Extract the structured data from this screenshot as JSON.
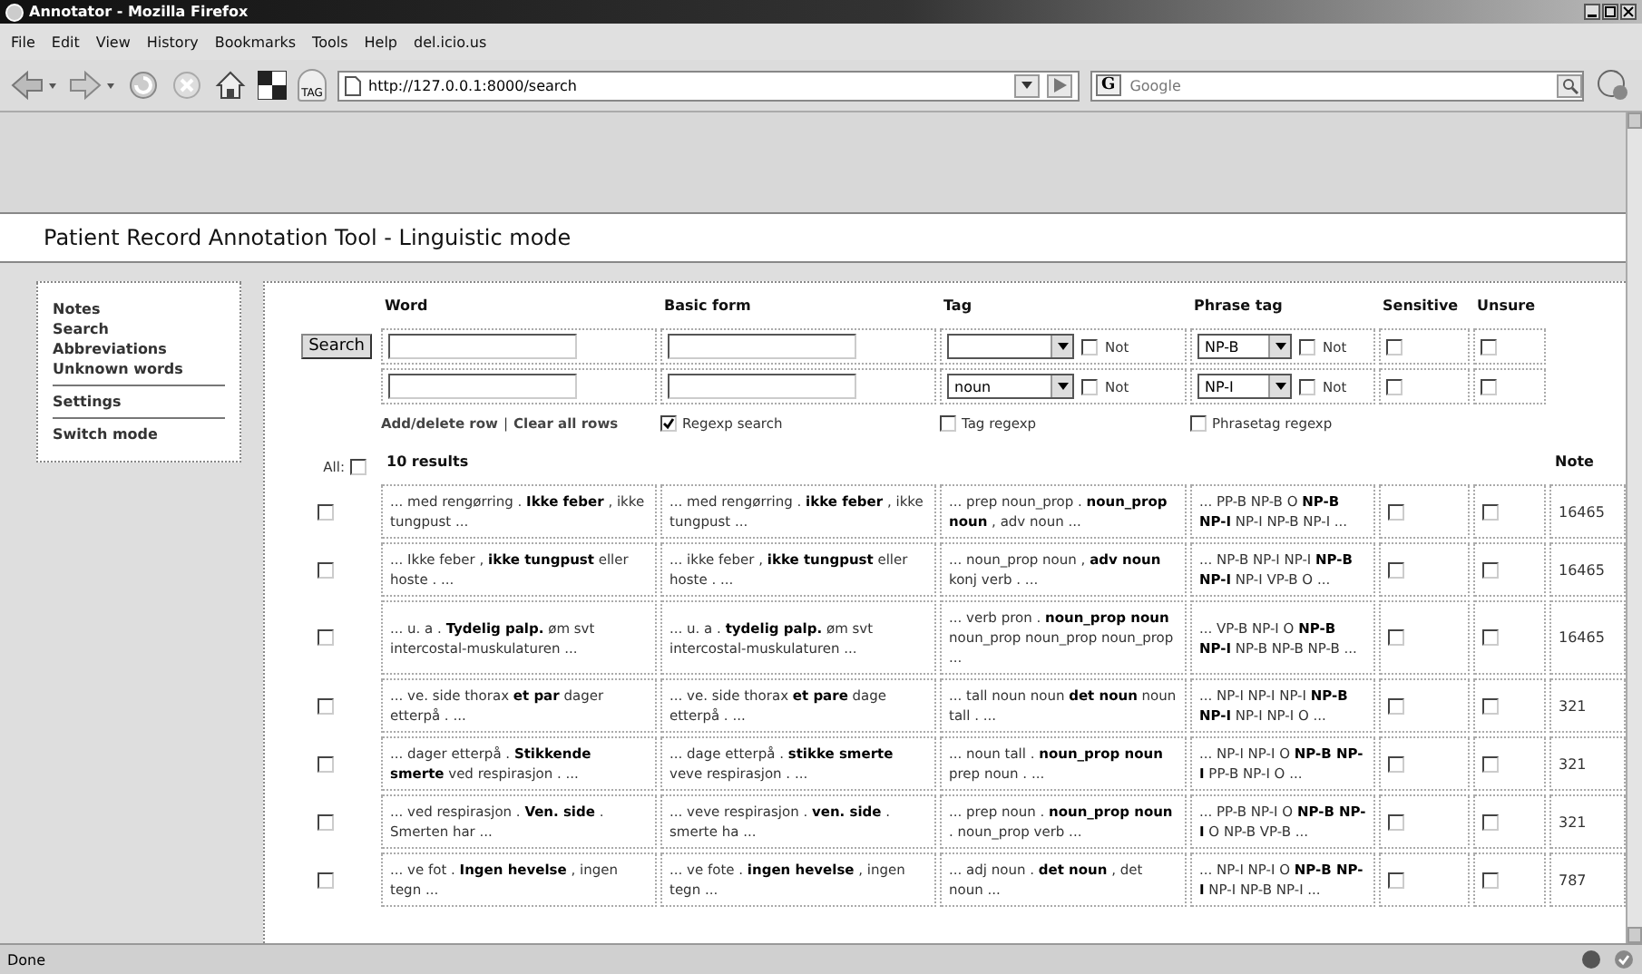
{
  "window": {
    "title": "Annotator - Mozilla Firefox"
  },
  "menu": [
    "File",
    "Edit",
    "View",
    "History",
    "Bookmarks",
    "Tools",
    "Help",
    "del.icio.us"
  ],
  "toolbar": {
    "tag_label": "TAG",
    "url": "http://127.0.0.1:8000/search",
    "search_engine": "G",
    "search_placeholder": "Google"
  },
  "page_title": "Patient Record Annotation Tool - Linguistic mode",
  "sidebar": {
    "groups": [
      [
        "Notes",
        "Search",
        "Abbreviations",
        "Unknown words"
      ],
      [
        "Settings"
      ],
      [
        "Switch mode"
      ]
    ]
  },
  "search": {
    "button": "Search",
    "columns": [
      "Word",
      "Basic form",
      "Tag",
      "Phrase tag",
      "Sensitive",
      "Unsure"
    ],
    "rows": [
      {
        "phrase_tag": "NP-B",
        "tag_not": {
          "label": "Not",
          "checked": false
        },
        "phrase_not": {
          "label": "Not",
          "checked": false
        },
        "sensitive": false,
        "unsure": false
      },
      {
        "tag": "noun",
        "phrase_tag": "NP-I",
        "tag_not": {
          "label": "Not",
          "checked": false
        },
        "phrase_not": {
          "label": "Not",
          "checked": false
        },
        "sensitive": false,
        "unsure": false
      }
    ],
    "links": [
      "Add/delete row",
      "Clear all rows"
    ],
    "link_separator": "|",
    "options": [
      {
        "label": "Regexp search",
        "checked": true
      },
      {
        "label": "Tag regexp",
        "checked": false
      },
      {
        "label": "Phrasetag regexp",
        "checked": false
      }
    ]
  },
  "results": {
    "all_label": "All:",
    "all_checked": false,
    "count": "10 results",
    "note_header": "Note",
    "rows": [
      {
        "checked": false,
        "word": "... med rengørring . **Ikke feber** , ikke tungpust ...",
        "basic_form": "... med rengørring . **ikke feber** , ikke tungpust ...",
        "tag": "... prep noun_prop . **noun_prop noun** , adv noun ...",
        "phrase_tag": "... PP-B NP-B O **NP-B NP-I** NP-I NP-B NP-I ...",
        "sensitive": false,
        "unsure": false,
        "note": "16465"
      },
      {
        "checked": false,
        "word": "... Ikke feber , **ikke tungpust** eller hoste . ...",
        "basic_form": "... ikke feber , **ikke tungpust** eller hoste . ...",
        "tag": "... noun_prop noun , **adv noun** konj verb . ...",
        "phrase_tag": "... NP-B NP-I NP-I **NP-B NP-I** NP-I VP-B O ...",
        "sensitive": false,
        "unsure": false,
        "note": "16465"
      },
      {
        "checked": false,
        "word": "... u. a . **Tydelig palp.** øm svt intercostal-muskulaturen ...",
        "basic_form": "... u. a . **tydelig palp.** øm svt intercostal-muskulaturen ...",
        "tag": "... verb pron . **noun_prop noun** noun_prop noun_prop noun_prop ...",
        "phrase_tag": "... VP-B NP-I O **NP-B NP-I** NP-B NP-B NP-B ...",
        "sensitive": false,
        "unsure": false,
        "note": "16465"
      },
      {
        "checked": false,
        "word": "... ve. side thorax **et par** dager etterpå . ...",
        "basic_form": "... ve. side thorax **et pare** dage etterpå . ...",
        "tag": "... tall noun noun **det noun** noun tall . ...",
        "phrase_tag": "... NP-I NP-I NP-I **NP-B NP-I** NP-I NP-I O ...",
        "sensitive": false,
        "unsure": false,
        "note": "321"
      },
      {
        "checked": false,
        "word": "... dager etterpå . **Stikkende smerte** ved respirasjon . ...",
        "basic_form": "... dage etterpå . **stikke smerte** veve respirasjon . ...",
        "tag": "... noun tall . **noun_prop noun** prep noun . ...",
        "phrase_tag": "... NP-I NP-I O **NP-B NP-I** PP-B NP-I O ...",
        "sensitive": false,
        "unsure": false,
        "note": "321"
      },
      {
        "checked": false,
        "word": "... ved respirasjon . **Ven. side** . Smerten har ...",
        "basic_form": "... veve respirasjon . **ven. side** . smerte ha ...",
        "tag": "... prep noun . **noun_prop noun** . noun_prop verb ...",
        "phrase_tag": "... PP-B NP-I O **NP-B NP-I** O NP-B VP-B ...",
        "sensitive": false,
        "unsure": false,
        "note": "321"
      },
      {
        "checked": false,
        "word": "... ve fot . **Ingen hevelse** , ingen tegn ...",
        "basic_form": "... ve fote . **ingen hevelse** , ingen tegn ...",
        "tag": "... adj noun . **det noun** , det noun ...",
        "phrase_tag": "... NP-I NP-I O **NP-B NP-I** NP-I NP-B NP-I ...",
        "sensitive": false,
        "unsure": false,
        "note": "787"
      }
    ]
  },
  "status_bar": {
    "text": "Done"
  }
}
